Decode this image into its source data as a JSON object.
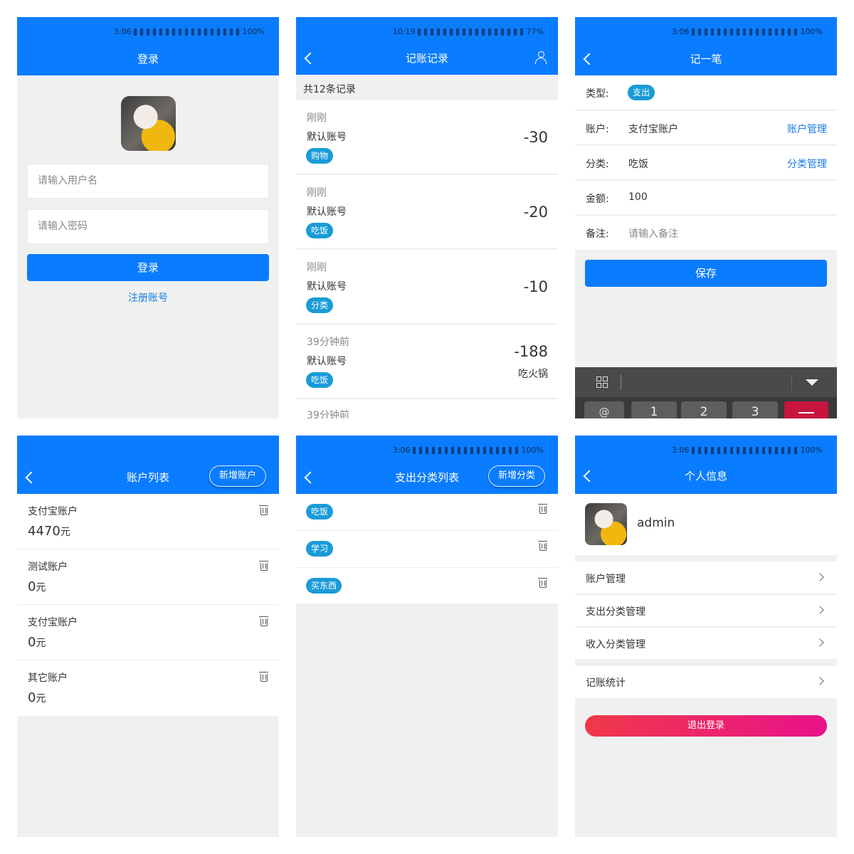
{
  "status": {
    "time_a": "3:06",
    "time_b": "10:19",
    "battery_full": "100%",
    "battery_77": "77%"
  },
  "login": {
    "title": "登录",
    "username_placeholder": "请输入用户名",
    "password_placeholder": "请输入密码",
    "login_button": "登录",
    "register_link": "注册账号"
  },
  "records": {
    "title": "记账记录",
    "count_text": "共12条记录",
    "items": [
      {
        "time": "刚刚",
        "account": "默认账号",
        "tag": "购物",
        "amount": "-30",
        "note": ""
      },
      {
        "time": "刚刚",
        "account": "默认账号",
        "tag": "吃饭",
        "amount": "-20",
        "note": ""
      },
      {
        "time": "刚刚",
        "account": "默认账号",
        "tag": "分类",
        "amount": "-10",
        "note": ""
      },
      {
        "time": "39分钟前",
        "account": "默认账号",
        "tag": "吃饭",
        "amount": "-188",
        "note": "吃火锅"
      },
      {
        "time": "39分钟前"
      }
    ]
  },
  "add_record": {
    "title": "记一笔",
    "type_label": "类型:",
    "type_value": "支出",
    "account_label": "账户:",
    "account_value": "支付宝账户",
    "account_manage": "账户管理",
    "category_label": "分类:",
    "category_value": "吃饭",
    "category_manage": "分类管理",
    "amount_label": "金额:",
    "amount_value": "100",
    "note_label": "备注:",
    "note_placeholder": "请输入备注",
    "save_button": "保存",
    "keys": [
      "@",
      "1",
      "2",
      "3"
    ]
  },
  "accounts": {
    "title": "账户列表",
    "add_button": "新增账户",
    "items": [
      {
        "name": "支付宝账户",
        "amount": "4470",
        "unit": "元"
      },
      {
        "name": "测试账户",
        "amount": "0",
        "unit": "元"
      },
      {
        "name": "支付宝账户",
        "amount": "0",
        "unit": "元"
      },
      {
        "name": "其它账户",
        "amount": "0",
        "unit": "元"
      }
    ]
  },
  "categories": {
    "title": "支出分类列表",
    "add_button": "新增分类",
    "items": [
      "吃饭",
      "学习",
      "买东西"
    ]
  },
  "profile": {
    "title": "个人信息",
    "username": "admin",
    "menu": [
      "账户管理",
      "支出分类管理",
      "收入分类管理"
    ],
    "menu2": [
      "记账统计"
    ],
    "logout_button": "退出登录"
  },
  "colors": {
    "primary": "#0a7cff",
    "tag": "#1a9bd8",
    "link": "#1a7ee0",
    "logout_start": "#f0394a",
    "logout_end": "#e8128a"
  }
}
